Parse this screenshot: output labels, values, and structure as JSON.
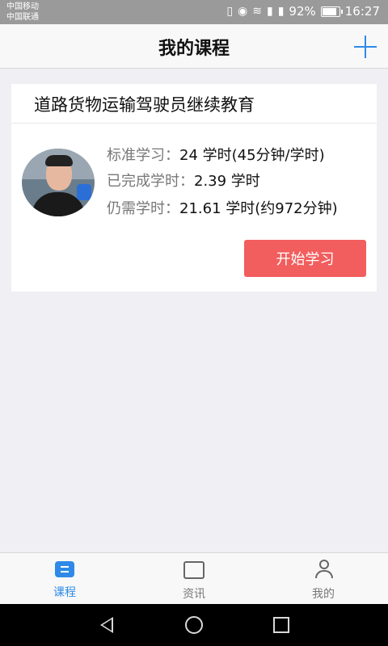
{
  "status_bar": {
    "carrier_1": "中国移动",
    "carrier_2": "中国联通",
    "battery": "92%",
    "time": "16:27",
    "battery_level": 0.92
  },
  "nav": {
    "title": "我的课程"
  },
  "course": {
    "title": "道路货物运输驾驶员继续教育",
    "rows": [
      {
        "label": "标准学习：",
        "value": "24 学时(45分钟/学时)"
      },
      {
        "label": "已完成学时：",
        "value": "2.39 学时"
      },
      {
        "label": "仍需学时：",
        "value": "21.61 学时(约972分钟)"
      }
    ],
    "start_button": "开始学习"
  },
  "tabs": [
    {
      "label": "课程",
      "icon": "courses-icon",
      "active": true
    },
    {
      "label": "资讯",
      "icon": "news-icon",
      "active": false
    },
    {
      "label": "我的",
      "icon": "person-icon",
      "active": false
    }
  ],
  "colors": {
    "accent": "#2e8ae6",
    "button": "#f25d5d",
    "background": "#efeff4"
  }
}
